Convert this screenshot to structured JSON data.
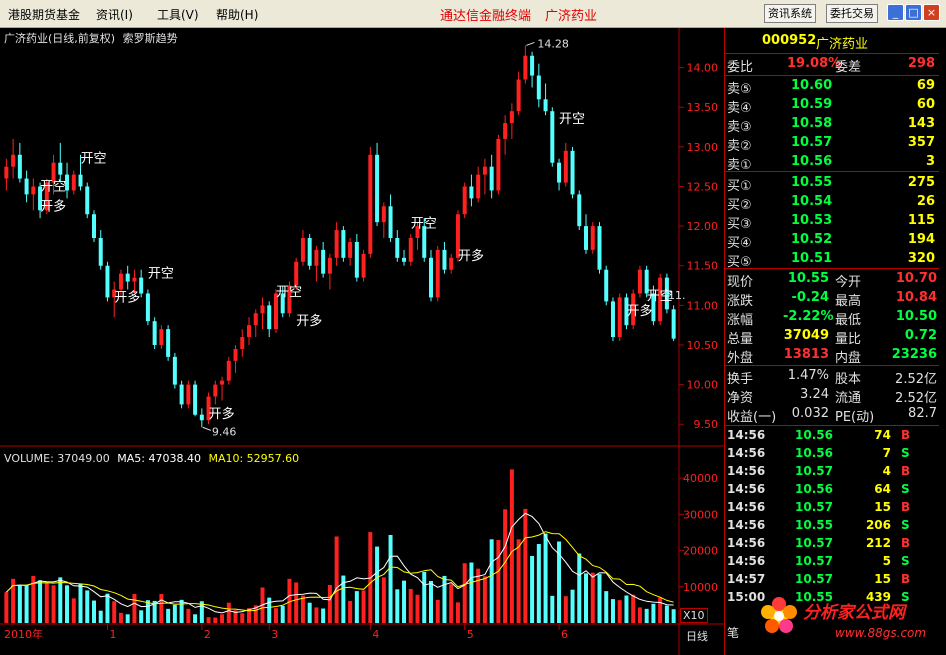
{
  "menu": [
    "港股期货基金",
    "资讯(I)",
    "工具(V)",
    "帮助(H)"
  ],
  "app_title": "通达信金融终端",
  "app_stock": "广济药业",
  "toolbar_buttons": [
    "资讯系统",
    "委托交易"
  ],
  "window_buttons": [
    "_",
    "□",
    "×"
  ],
  "chart_header": {
    "title": "广济药业(日线,前复权)",
    "indicator": "索罗斯趋势"
  },
  "volume_header": {
    "volume": "VOLUME: 37049.00",
    "ma5": "MA5: 47038.40",
    "ma10": "MA10: 52957.60"
  },
  "price_axis": [
    "14.00",
    "13.50",
    "13.00",
    "12.50",
    "12.00",
    "11.50",
    "11.00",
    "10.50",
    "10.00",
    "9.50"
  ],
  "volume_axis": [
    "40000",
    "30000",
    "20000",
    "10000"
  ],
  "volume_unit": "X10",
  "x_axis": [
    "2010年",
    "1",
    "2",
    "3",
    "4",
    "5",
    "6"
  ],
  "period_tab": "日线",
  "high_label": "14.28",
  "low_label": "9.46",
  "clipped_label": "11.",
  "signals": [
    {
      "text": "开空",
      "c": 5,
      "v": 12.45
    },
    {
      "text": "开多",
      "c": 5,
      "v": 12.2
    },
    {
      "text": "开空",
      "c": 11,
      "v": 12.8
    },
    {
      "text": "开空",
      "c": 21,
      "v": 11.35
    },
    {
      "text": "开多",
      "c": 16,
      "v": 11.05
    },
    {
      "text": "开空",
      "c": 40,
      "v": 11.12
    },
    {
      "text": "开多",
      "c": 43,
      "v": 10.75
    },
    {
      "text": "开多",
      "c": 30,
      "v": 9.58
    },
    {
      "text": "开空",
      "c": 60,
      "v": 11.98
    },
    {
      "text": "开多",
      "c": 67,
      "v": 11.57
    },
    {
      "text": "开空",
      "c": 82,
      "v": 13.3
    },
    {
      "text": "开多",
      "c": 92,
      "v": 10.88
    },
    {
      "text": "开空",
      "c": 95,
      "v": 11.07
    }
  ],
  "quote": {
    "code": "000952",
    "name": "广济药业",
    "weibi": {
      "label": "委比",
      "value": "19.08%",
      "label2": "委差",
      "value2": "298"
    },
    "sells": [
      {
        "label": "卖⑤",
        "price": "10.60",
        "vol": "69"
      },
      {
        "label": "卖④",
        "price": "10.59",
        "vol": "60"
      },
      {
        "label": "卖③",
        "price": "10.58",
        "vol": "143"
      },
      {
        "label": "卖②",
        "price": "10.57",
        "vol": "357"
      },
      {
        "label": "卖①",
        "price": "10.56",
        "vol": "3"
      }
    ],
    "buys": [
      {
        "label": "买①",
        "price": "10.55",
        "vol": "275"
      },
      {
        "label": "买②",
        "price": "10.54",
        "vol": "26"
      },
      {
        "label": "买③",
        "price": "10.53",
        "vol": "115"
      },
      {
        "label": "买④",
        "price": "10.52",
        "vol": "194"
      },
      {
        "label": "买⑤",
        "price": "10.51",
        "vol": "320"
      }
    ],
    "stats": [
      {
        "l1": "现价",
        "v1": "10.55",
        "c1": "#00ff40",
        "l2": "今开",
        "v2": "10.70",
        "c2": "#ff3030"
      },
      {
        "l1": "涨跌",
        "v1": "-0.24",
        "c1": "#00ff40",
        "l2": "最高",
        "v2": "10.84",
        "c2": "#ff3030"
      },
      {
        "l1": "涨幅",
        "v1": "-2.22%",
        "c1": "#00ff40",
        "l2": "最低",
        "v2": "10.50",
        "c2": "#00ff40"
      },
      {
        "l1": "总量",
        "v1": "37049",
        "c1": "#ffff00",
        "l2": "量比",
        "v2": "0.72",
        "c2": "#00ff40"
      },
      {
        "l1": "外盘",
        "v1": "13813",
        "c1": "#ff3030",
        "l2": "内盘",
        "v2": "23236",
        "c2": "#00ff40"
      }
    ],
    "extra": [
      {
        "l1": "换手",
        "v1": "1.47%",
        "l2": "股本",
        "v2": "2.52亿"
      },
      {
        "l1": "净资",
        "v1": "3.24",
        "l2": "流通",
        "v2": "2.52亿"
      },
      {
        "l1": "收益(一)",
        "v1": "0.032",
        "l2": "PE(动)",
        "v2": "82.7"
      }
    ],
    "ticks": [
      {
        "time": "14:56",
        "price": "10.56",
        "vol": "74",
        "bs": "B"
      },
      {
        "time": "14:56",
        "price": "10.56",
        "vol": "7",
        "bs": "S"
      },
      {
        "time": "14:56",
        "price": "10.57",
        "vol": "4",
        "bs": "B"
      },
      {
        "time": "14:56",
        "price": "10.56",
        "vol": "64",
        "bs": "S"
      },
      {
        "time": "14:56",
        "price": "10.57",
        "vol": "15",
        "bs": "B"
      },
      {
        "time": "14:56",
        "price": "10.55",
        "vol": "206",
        "bs": "S"
      },
      {
        "time": "14:56",
        "price": "10.57",
        "vol": "212",
        "bs": "B"
      },
      {
        "time": "14:56",
        "price": "10.57",
        "vol": "5",
        "bs": "S"
      },
      {
        "time": "14:57",
        "price": "10.57",
        "vol": "15",
        "bs": "B"
      },
      {
        "time": "15:00",
        "price": "10.55",
        "vol": "439",
        "bs": "S"
      }
    ],
    "tab_partial": "笔"
  },
  "colors": {
    "up": "#ff2020",
    "down": "#54ffff",
    "panel_label": "#e0e0e0",
    "border": "#b00000",
    "ma5": "#ffffff",
    "ma10": "#ffff00"
  },
  "watermark": {
    "text": "分析家公式网",
    "url": "www.88gs.com"
  },
  "chart_data": {
    "type": "candlestick",
    "series": [
      {
        "name": "price",
        "ohlc": [
          [
            12.6,
            12.85,
            12.45,
            12.75
          ],
          [
            12.75,
            13.1,
            12.6,
            12.9
          ],
          [
            12.9,
            13.05,
            12.55,
            12.6
          ],
          [
            12.6,
            12.7,
            12.3,
            12.4
          ],
          [
            12.4,
            12.6,
            12.2,
            12.5
          ],
          [
            12.5,
            12.55,
            12.1,
            12.2
          ],
          [
            12.2,
            12.6,
            12.15,
            12.55
          ],
          [
            12.55,
            12.9,
            12.4,
            12.8
          ],
          [
            12.8,
            13.05,
            12.55,
            12.65
          ],
          [
            12.65,
            12.8,
            12.35,
            12.45
          ],
          [
            12.45,
            12.7,
            12.4,
            12.65
          ],
          [
            12.65,
            12.9,
            12.45,
            12.5
          ],
          [
            12.5,
            12.55,
            12.1,
            12.15
          ],
          [
            12.15,
            12.2,
            11.8,
            11.85
          ],
          [
            11.85,
            11.95,
            11.45,
            11.5
          ],
          [
            11.5,
            11.55,
            11.05,
            11.1
          ],
          [
            11.1,
            11.3,
            10.85,
            11.2
          ],
          [
            11.2,
            11.45,
            11.1,
            11.4
          ],
          [
            11.4,
            11.5,
            11.2,
            11.3
          ],
          [
            11.3,
            11.45,
            11.15,
            11.35
          ],
          [
            11.35,
            11.45,
            11.1,
            11.15
          ],
          [
            11.15,
            11.2,
            10.75,
            10.8
          ],
          [
            10.8,
            10.85,
            10.45,
            10.5
          ],
          [
            10.5,
            10.75,
            10.45,
            10.7
          ],
          [
            10.7,
            10.75,
            10.3,
            10.35
          ],
          [
            10.35,
            10.4,
            9.95,
            10.0
          ],
          [
            10.0,
            10.05,
            9.7,
            9.75
          ],
          [
            9.75,
            10.05,
            9.7,
            10.0
          ],
          [
            10.0,
            10.05,
            9.6,
            9.62
          ],
          [
            9.62,
            9.7,
            9.46,
            9.55
          ],
          [
            9.55,
            9.9,
            9.5,
            9.85
          ],
          [
            9.85,
            10.05,
            9.75,
            10.0
          ],
          [
            10.0,
            10.1,
            9.8,
            10.05
          ],
          [
            10.05,
            10.35,
            10.0,
            10.3
          ],
          [
            10.3,
            10.5,
            10.15,
            10.45
          ],
          [
            10.45,
            10.7,
            10.35,
            10.6
          ],
          [
            10.6,
            10.85,
            10.5,
            10.75
          ],
          [
            10.75,
            10.95,
            10.6,
            10.9
          ],
          [
            10.9,
            11.1,
            10.7,
            11.0
          ],
          [
            11.0,
            11.05,
            10.6,
            10.7
          ],
          [
            10.7,
            11.2,
            10.65,
            11.15
          ],
          [
            11.15,
            11.25,
            10.85,
            10.9
          ],
          [
            10.9,
            11.3,
            10.85,
            11.25
          ],
          [
            11.25,
            11.6,
            11.2,
            11.55
          ],
          [
            11.55,
            11.95,
            11.5,
            11.85
          ],
          [
            11.85,
            11.9,
            11.45,
            11.5
          ],
          [
            11.5,
            11.75,
            11.3,
            11.7
          ],
          [
            11.7,
            11.8,
            11.35,
            11.4
          ],
          [
            11.4,
            11.65,
            11.2,
            11.6
          ],
          [
            11.6,
            12.05,
            11.5,
            11.95
          ],
          [
            11.95,
            12.0,
            11.55,
            11.6
          ],
          [
            11.6,
            11.85,
            11.5,
            11.8
          ],
          [
            11.8,
            11.9,
            11.3,
            11.35
          ],
          [
            11.35,
            11.7,
            11.3,
            11.65
          ],
          [
            11.65,
            13.0,
            11.6,
            12.9
          ],
          [
            12.9,
            13.05,
            12.0,
            12.05
          ],
          [
            12.05,
            12.3,
            11.85,
            12.25
          ],
          [
            12.25,
            12.4,
            11.8,
            11.85
          ],
          [
            11.85,
            11.95,
            11.55,
            11.6
          ],
          [
            11.6,
            11.7,
            11.5,
            11.55
          ],
          [
            11.55,
            11.9,
            11.5,
            11.85
          ],
          [
            11.85,
            12.05,
            11.7,
            12.0
          ],
          [
            12.0,
            12.1,
            11.55,
            11.6
          ],
          [
            11.6,
            11.7,
            11.05,
            11.1
          ],
          [
            11.1,
            11.75,
            11.05,
            11.7
          ],
          [
            11.7,
            11.8,
            11.4,
            11.45
          ],
          [
            11.45,
            11.65,
            11.4,
            11.6
          ],
          [
            11.6,
            12.2,
            11.55,
            12.15
          ],
          [
            12.15,
            12.55,
            12.1,
            12.5
          ],
          [
            12.5,
            12.65,
            12.25,
            12.35
          ],
          [
            12.35,
            12.75,
            12.3,
            12.65
          ],
          [
            12.65,
            12.85,
            12.4,
            12.75
          ],
          [
            12.75,
            12.9,
            12.35,
            12.45
          ],
          [
            12.45,
            13.15,
            12.4,
            13.1
          ],
          [
            13.1,
            13.4,
            12.9,
            13.3
          ],
          [
            13.3,
            13.55,
            13.1,
            13.45
          ],
          [
            13.45,
            13.95,
            13.4,
            13.85
          ],
          [
            13.85,
            14.28,
            13.8,
            14.15
          ],
          [
            14.15,
            14.2,
            13.75,
            13.9
          ],
          [
            13.9,
            14.05,
            13.5,
            13.6
          ],
          [
            13.6,
            13.8,
            13.4,
            13.45
          ],
          [
            13.45,
            13.5,
            12.75,
            12.8
          ],
          [
            12.8,
            12.85,
            12.45,
            12.55
          ],
          [
            12.55,
            13.05,
            12.5,
            12.95
          ],
          [
            12.95,
            13.0,
            12.35,
            12.4
          ],
          [
            12.4,
            12.45,
            11.95,
            12.0
          ],
          [
            12.0,
            12.15,
            11.65,
            11.7
          ],
          [
            11.7,
            12.05,
            11.65,
            12.0
          ],
          [
            12.0,
            12.05,
            11.4,
            11.45
          ],
          [
            11.45,
            11.5,
            11.0,
            11.05
          ],
          [
            11.05,
            11.1,
            10.55,
            10.6
          ],
          [
            10.6,
            11.15,
            10.55,
            11.1
          ],
          [
            11.1,
            11.15,
            10.7,
            10.75
          ],
          [
            10.75,
            11.2,
            10.7,
            11.15
          ],
          [
            11.15,
            11.5,
            11.1,
            11.45
          ],
          [
            11.45,
            11.5,
            11.1,
            11.15
          ],
          [
            11.15,
            11.25,
            10.75,
            10.8
          ],
          [
            10.8,
            11.4,
            10.75,
            11.35
          ],
          [
            11.35,
            11.4,
            10.9,
            10.95
          ],
          [
            10.95,
            11.0,
            10.55,
            10.58
          ]
        ]
      },
      {
        "name": "VOLUME",
        "values": [
          8500,
          12200,
          10600,
          10400,
          13000,
          11800,
          11200,
          10400,
          12600,
          10400,
          6800,
          10800,
          9000,
          6200,
          3400,
          8100,
          6000,
          2800,
          2400,
          8000,
          3500,
          6300,
          6100,
          8000,
          3900,
          5000,
          6400,
          3900,
          2400,
          6000,
          1600,
          1500,
          2400,
          5600,
          3500,
          2700,
          4100,
          4900,
          9800,
          7000,
          4100,
          4700,
          12200,
          11200,
          7600,
          5600,
          4300,
          4000,
          10500,
          23900,
          13100,
          6100,
          8800,
          9000,
          25100,
          21100,
          12600,
          24300,
          9300,
          11700,
          9400,
          7800,
          14100,
          11600,
          6400,
          13000,
          10700,
          5700,
          16500,
          16700,
          15000,
          12900,
          23100,
          22900,
          31400,
          42400,
          23100,
          31500,
          18500,
          21800,
          24700,
          7500,
          22500,
          7400,
          9200,
          19200,
          13700,
          13900,
          13500,
          8800,
          6600,
          6300,
          7600,
          7800,
          4300,
          3900,
          5300,
          7000,
          4800,
          3800
        ]
      },
      {
        "name": "MA5"
      },
      {
        "name": "MA10"
      }
    ],
    "y_price_range": [
      9.2,
      14.5
    ],
    "y_volume_range": [
      0,
      45000
    ],
    "x_labels": [
      "2010年",
      "1",
      "2",
      "3",
      "4",
      "5",
      "6"
    ],
    "x_label_index": [
      0,
      15,
      29,
      39,
      54,
      68,
      82
    ],
    "high": 14.28,
    "low": 9.46
  }
}
